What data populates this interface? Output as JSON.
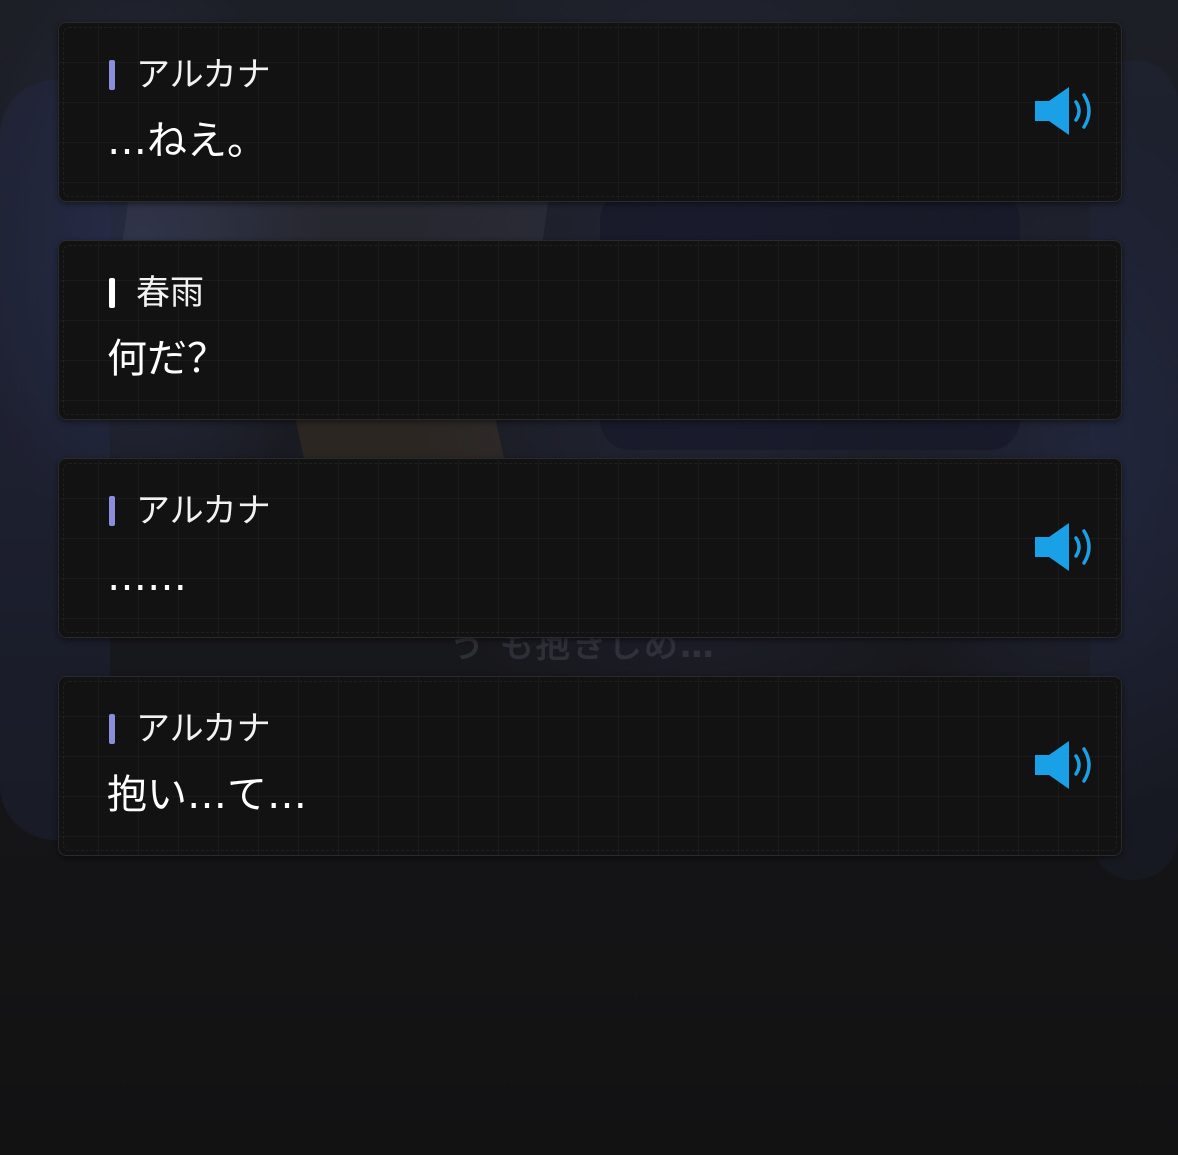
{
  "colors": {
    "accent_voice": "#1aa0e6",
    "speaker_bar_heroine": "#8c8cdc",
    "speaker_bar_player": "#ffffff"
  },
  "background_text": "う も抱きしめ…",
  "entries": [
    {
      "speaker": "アルカナ",
      "text": "…ねえ。",
      "has_voice": true,
      "voice_icon": "speaker-icon"
    },
    {
      "speaker": "春雨",
      "text": "何だ？",
      "has_voice": false
    },
    {
      "speaker": "アルカナ",
      "text": "……",
      "has_voice": true,
      "voice_icon": "speaker-icon"
    },
    {
      "speaker": "アルカナ",
      "text": "抱い…て…",
      "has_voice": true,
      "voice_icon": "speaker-icon"
    }
  ]
}
